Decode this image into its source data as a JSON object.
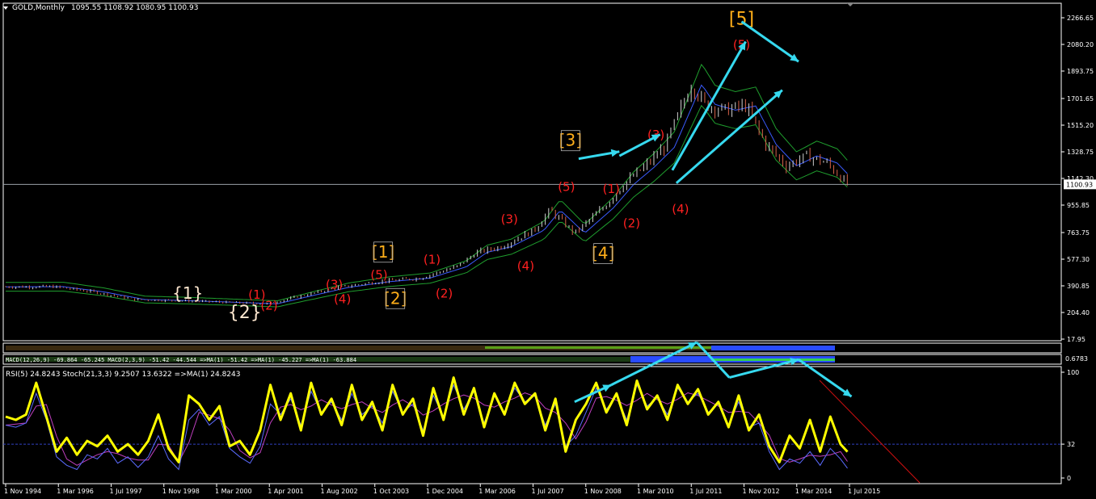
{
  "header": {
    "symbol": "GOLD,Monthly",
    "ohlc": "1095.55 1108.92 1080.95 1100.93",
    "indicator_strip": "MACD(12,26,9) -69.864 -65.245  MACD(2,3,9) -51.42 -44.544  =>MA(1) -51.42 =>MA(1) -45.227  =>MA(1) -63.884",
    "lower_label": "RSI(5) 24.8243  Stoch(21,3,3) 9.2507 13.6322  =>MA(1) 24.8243",
    "strip_scale": "0.6783"
  },
  "colors": {
    "background": "#000000",
    "axis": "#ffffff",
    "bull_candle": "#d0d0d0",
    "bear_candle": "#d7634a",
    "bollinger": "#1f9e2e",
    "ma": "#3a5bff",
    "rsi": "#ffff00",
    "stoch_main": "#5b6bff",
    "stoch_signal": "#c040c0",
    "wave_red": "#ff2020",
    "wave_orange": "#ffae19",
    "wave_white": "#ffe8d0",
    "arrow": "#36d9ef",
    "trendline": "#d01010",
    "level_dashed": "#3040c0"
  },
  "chart_data": [
    {
      "type": "candlestick",
      "title": "GOLD,Monthly",
      "y_ticks": [
        "2266.65",
        "2080.20",
        "1893.75",
        "1701.65",
        "1515.20",
        "1328.75",
        "1142.30",
        "955.85",
        "763.75",
        "577.30",
        "390.85",
        "204.40",
        "17.95"
      ],
      "y_range": [
        17.95,
        2266.65
      ],
      "current_price": "1100.93",
      "x_ticks": [
        "1 Nov 1994",
        "1 Mar 1996",
        "1 Jul 1997",
        "1 Nov 1998",
        "1 Mar 2000",
        "1 Apr 2001",
        "1 Aug 2002",
        "1 Oct 2003",
        "1 Dec 2004",
        "1 Mar 2006",
        "1 Jul 2007",
        "1 Nov 2008",
        "1 Mar 2010",
        "1 Jul 2011",
        "1 Nov 2012",
        "1 Mar 2014",
        "1 Jul 2015"
      ],
      "close_path_years": [
        1994.83,
        1996.0,
        1997.0,
        1998.0,
        1999.0,
        2000.0,
        2001.25,
        2002.0,
        2003.0,
        2004.0,
        2005.0,
        2005.9,
        2006.4,
        2007.0,
        2007.8,
        2008.2,
        2008.8,
        2009.5,
        2010.0,
        2010.5,
        2011.0,
        2011.67,
        2012.0,
        2012.5,
        2013.0,
        2013.5,
        2014.0,
        2014.5,
        2015.0,
        2015.5
      ],
      "close_path_values": [
        384,
        385,
        348,
        295,
        288,
        278,
        265,
        315,
        380,
        420,
        445,
        525,
        625,
        665,
        780,
        920,
        760,
        935,
        1100,
        1220,
        1360,
        1800,
        1660,
        1620,
        1650,
        1380,
        1230,
        1300,
        1250,
        1100
      ],
      "wave_labels": [
        {
          "text": "{1}",
          "x": 1999.3,
          "y": 300,
          "color": "wave_white",
          "size": 20
        },
        {
          "text": "{2}",
          "x": 2000.7,
          "y": 165,
          "color": "wave_white",
          "size": 22
        },
        {
          "text": "(1)",
          "x": 2001.0,
          "y": 300,
          "color": "wave_red",
          "size": 15
        },
        {
          "text": "(2)",
          "x": 2001.3,
          "y": 225,
          "color": "wave_red",
          "size": 15
        },
        {
          "text": "(3)",
          "x": 2002.9,
          "y": 370,
          "color": "wave_red",
          "size": 15
        },
        {
          "text": "(4)",
          "x": 2003.1,
          "y": 270,
          "color": "wave_red",
          "size": 15
        },
        {
          "text": "(5)",
          "x": 2004.0,
          "y": 440,
          "color": "wave_red",
          "size": 15
        },
        {
          "text": "[1]",
          "x": 2004.1,
          "y": 590,
          "color": "wave_orange",
          "size": 20
        },
        {
          "text": "(1)",
          "x": 2005.3,
          "y": 545,
          "color": "wave_red",
          "size": 15
        },
        {
          "text": "[2]",
          "x": 2004.4,
          "y": 265,
          "color": "wave_orange",
          "size": 20
        },
        {
          "text": "(2)",
          "x": 2005.6,
          "y": 310,
          "color": "wave_red",
          "size": 15
        },
        {
          "text": "(3)",
          "x": 2007.2,
          "y": 830,
          "color": "wave_red",
          "size": 15
        },
        {
          "text": "(4)",
          "x": 2007.6,
          "y": 500,
          "color": "wave_red",
          "size": 15
        },
        {
          "text": "(5)",
          "x": 2008.6,
          "y": 1055,
          "color": "wave_red",
          "size": 15
        },
        {
          "text": "[3]",
          "x": 2008.7,
          "y": 1370,
          "color": "wave_orange",
          "size": 20
        },
        {
          "text": "(1)",
          "x": 2009.7,
          "y": 1040,
          "color": "wave_red",
          "size": 15
        },
        {
          "text": "[4]",
          "x": 2009.5,
          "y": 580,
          "color": "wave_orange",
          "size": 20
        },
        {
          "text": "(2)",
          "x": 2010.2,
          "y": 800,
          "color": "wave_red",
          "size": 15
        },
        {
          "text": "(3)",
          "x": 2010.8,
          "y": 1420,
          "color": "wave_red",
          "size": 15
        },
        {
          "text": "(4)",
          "x": 2011.4,
          "y": 900,
          "color": "wave_red",
          "size": 15
        },
        {
          "text": "(5)",
          "x": 2012.9,
          "y": 2050,
          "color": "wave_red",
          "size": 15
        },
        {
          "text": "[5]",
          "x": 2012.9,
          "y": 2220,
          "color": "wave_orange",
          "size": 22
        }
      ]
    },
    {
      "type": "line",
      "title": "RSI(5) 24.8243  Stoch(21,3,3) 9.2507 13.6322  =>MA(1) 24.8243",
      "y_ticks": [
        "100",
        "32",
        "0"
      ],
      "y_range": [
        0,
        100
      ],
      "level": 32,
      "x": [
        1994.83,
        1995.08,
        1995.33,
        1995.58,
        1995.83,
        1996.08,
        1996.33,
        1996.58,
        1996.83,
        1997.08,
        1997.33,
        1997.58,
        1997.83,
        1998.08,
        1998.33,
        1998.58,
        1998.83,
        1999.08,
        1999.33,
        1999.58,
        1999.83,
        2000.08,
        2000.33,
        2000.58,
        2000.83,
        2001.08,
        2001.33,
        2001.58,
        2001.83,
        2002.08,
        2002.33,
        2002.58,
        2002.83,
        2003.08,
        2003.33,
        2003.58,
        2003.83,
        2004.08,
        2004.33,
        2004.58,
        2004.83,
        2005.08,
        2005.33,
        2005.58,
        2005.83,
        2006.08,
        2006.33,
        2006.58,
        2006.83,
        2007.08,
        2007.33,
        2007.58,
        2007.83,
        2008.08,
        2008.33,
        2008.58,
        2008.83,
        2009.08,
        2009.33,
        2009.58,
        2009.83,
        2010.08,
        2010.33,
        2010.58,
        2010.83,
        2011.08,
        2011.33,
        2011.58,
        2011.83,
        2012.08,
        2012.33,
        2012.58,
        2012.83,
        2013.08,
        2013.33,
        2013.58,
        2013.83,
        2014.08,
        2014.33,
        2014.58,
        2014.83,
        2015.08,
        2015.33,
        2015.5
      ],
      "series": [
        {
          "key": "rsi",
          "values": [
            58,
            55,
            60,
            90,
            58,
            25,
            38,
            22,
            35,
            30,
            40,
            25,
            32,
            22,
            35,
            60,
            28,
            15,
            78,
            70,
            55,
            68,
            30,
            35,
            22,
            45,
            88,
            55,
            80,
            45,
            90,
            60,
            75,
            50,
            88,
            55,
            72,
            45,
            88,
            60,
            75,
            40,
            85,
            55,
            95,
            60,
            85,
            48,
            80,
            60,
            90,
            70,
            80,
            45,
            75,
            25,
            55,
            70,
            90,
            62,
            80,
            50,
            92,
            65,
            78,
            55,
            88,
            70,
            84,
            60,
            72,
            48,
            78,
            45,
            60,
            30,
            15,
            40,
            28,
            55,
            25,
            58,
            32,
            24.8
          ]
        },
        {
          "key": "stoch",
          "values": [
            50,
            48,
            52,
            80,
            55,
            20,
            12,
            8,
            22,
            18,
            28,
            14,
            20,
            10,
            20,
            40,
            18,
            8,
            55,
            65,
            50,
            58,
            28,
            20,
            14,
            30,
            70,
            60,
            75,
            50,
            82,
            62,
            72,
            55,
            80,
            60,
            68,
            52,
            82,
            62,
            70,
            45,
            78,
            58,
            88,
            65,
            82,
            52,
            78,
            62,
            85,
            72,
            78,
            50,
            70,
            30,
            40,
            62,
            85,
            65,
            78,
            55,
            88,
            68,
            76,
            60,
            85,
            72,
            80,
            62,
            70,
            50,
            72,
            48,
            52,
            25,
            8,
            18,
            14,
            25,
            12,
            28,
            18,
            9.25
          ]
        }
      ]
    }
  ],
  "annotations": {
    "arrows": [
      {
        "from": [
          2008.9,
          1280
        ],
        "to": [
          2009.9,
          1330
        ]
      },
      {
        "from": [
          2009.9,
          1300
        ],
        "to": [
          2010.9,
          1450
        ]
      },
      {
        "from": [
          2011.2,
          1200
        ],
        "to": [
          2013.0,
          2100
        ]
      },
      {
        "from": [
          2012.9,
          2240
        ],
        "to": [
          2014.3,
          1960
        ]
      },
      {
        "from": [
          2011.3,
          1110
        ],
        "to": [
          2013.9,
          1760
        ]
      }
    ],
    "rsi_arrows": [
      {
        "from": [
          2008.8,
          72
        ],
        "to": [
          2009.7,
          88
        ]
      },
      {
        "from": [
          2009.7,
          88
        ],
        "to": [
          2011.8,
          130
        ]
      },
      {
        "from": [
          2011.8,
          130
        ],
        "to": [
          2012.6,
          95
        ]
      },
      {
        "from": [
          2012.6,
          95
        ],
        "to": [
          2014.3,
          112
        ]
      },
      {
        "from": [
          2014.3,
          112
        ],
        "to": [
          2015.6,
          77
        ]
      }
    ]
  }
}
